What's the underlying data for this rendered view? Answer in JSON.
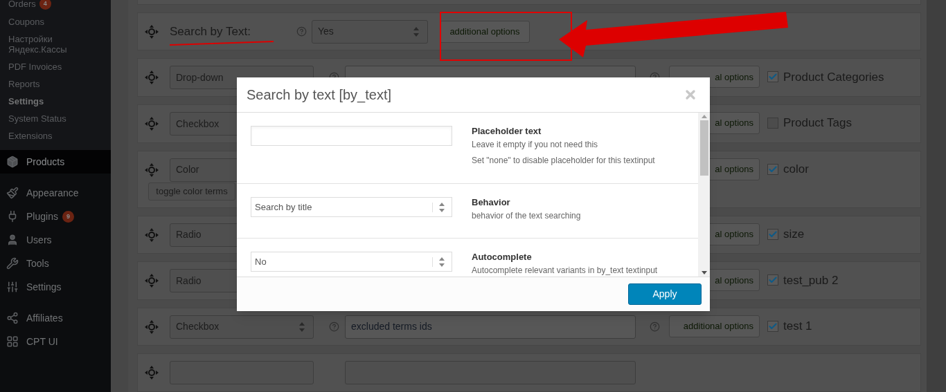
{
  "sidebar": {
    "submenu": [
      {
        "label": "Orders",
        "badge": "4",
        "selected": false
      },
      {
        "label": "Coupons",
        "selected": false
      },
      {
        "label": "Настройки Яндекс.Кассы",
        "selected": false
      },
      {
        "label": "PDF Invoices",
        "selected": false
      },
      {
        "label": "Reports",
        "selected": false
      },
      {
        "label": "Settings",
        "selected": true
      },
      {
        "label": "System Status",
        "selected": false
      },
      {
        "label": "Extensions",
        "selected": false
      }
    ],
    "menu": [
      {
        "label": "Products",
        "current": true
      },
      {
        "label": "Appearance",
        "current": false
      },
      {
        "label": "Plugins",
        "badge": "9",
        "current": false
      },
      {
        "label": "Users",
        "current": false
      },
      {
        "label": "Tools",
        "current": false
      },
      {
        "label": "Settings",
        "current": false
      },
      {
        "label": "Affiliates",
        "current": false
      },
      {
        "label": "CPT UI",
        "current": false
      }
    ]
  },
  "filter_rows": [
    {
      "kind": "text_search",
      "label": "Search by Text:",
      "value": "Yes",
      "button": "additional options"
    },
    {
      "kind": "taxonomy",
      "type": "Drop-down",
      "button": "al options",
      "checked": true,
      "label": "Product Categories"
    },
    {
      "kind": "taxonomy",
      "type": "Checkbox",
      "button": "al options",
      "checked": false,
      "label": "Product Tags"
    },
    {
      "kind": "taxonomy",
      "type": "Color",
      "toggle": "toggle color terms",
      "button": "al options",
      "checked": true,
      "label": "color"
    },
    {
      "kind": "taxonomy",
      "type": "Radio",
      "button": "al options",
      "checked": true,
      "label": "size"
    },
    {
      "kind": "taxonomy",
      "type": "Radio",
      "button": "al options",
      "checked": true,
      "label": "test_pub 2"
    },
    {
      "kind": "taxonomy",
      "type": "Checkbox",
      "placeholder": "excluded terms ids",
      "button": "additional options",
      "checked": true,
      "label": "test 1"
    },
    {
      "kind": "partial"
    }
  ],
  "modal": {
    "title": "Search by text [by_text]",
    "fields": [
      {
        "kind": "text",
        "label": "Placeholder text",
        "hints": [
          "Leave it empty if you not need this",
          "Set \"none\" to disable placeholder for this textinput"
        ]
      },
      {
        "kind": "select",
        "value": "Search by title",
        "label": "Behavior",
        "hints": [
          "behavior of the text searching"
        ]
      },
      {
        "kind": "select",
        "value": "No",
        "label": "Autocomplete",
        "hints": [
          "Autocomplete relevant variants in by_text textinput"
        ]
      }
    ],
    "apply": "Apply"
  }
}
